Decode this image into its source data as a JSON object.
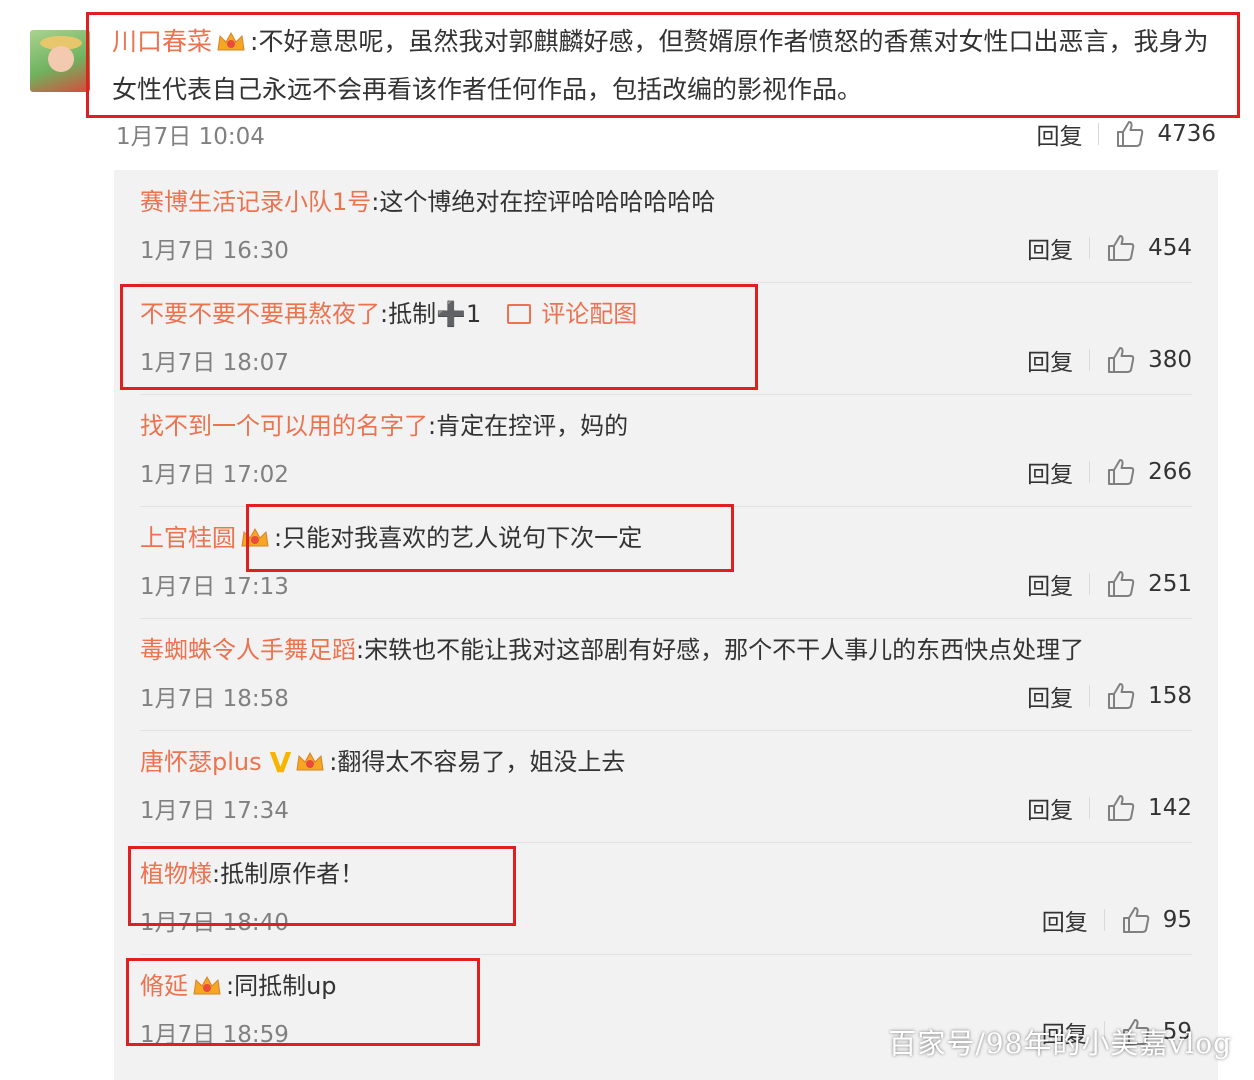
{
  "main_comment": {
    "username": "川口春菜",
    "separator": ":",
    "text": "不好意思呢，虽然我对郭麒麟好感，但赘婿原作者愤怒的香蕉对女性口出恶言，我身为女性代表自己永远不会再看该作者任何作品，包括改编的影视作品。",
    "time": "1月7日 10:04",
    "reply_label": "回复",
    "likes": "4736"
  },
  "replies": [
    {
      "username": "赛博生活记录小队1号",
      "sep": ":",
      "text": "这个博绝对在控评哈哈哈哈哈哈",
      "time": "1月7日 16:30",
      "reply_label": "回复",
      "likes": "454"
    },
    {
      "username": "不要不要不要再熬夜了",
      "sep": ":",
      "text": "抵制",
      "emoji": "➕",
      "text2": "1",
      "pic_label": "评论配图",
      "time": "1月7日 18:07",
      "reply_label": "回复",
      "likes": "380"
    },
    {
      "username": "找不到一个可以用的名字了",
      "sep": ":",
      "text": "肯定在控评，妈的",
      "time": "1月7日 17:02",
      "reply_label": "回复",
      "likes": "266"
    },
    {
      "username": "上官桂圆",
      "sep": ":",
      "text": "只能对我喜欢的艺人说句下次一定",
      "time": "1月7日 17:13",
      "reply_label": "回复",
      "likes": "251"
    },
    {
      "username": "毒蜘蛛令人手舞足蹈",
      "sep": ":",
      "text": "宋轶也不能让我对这部剧有好感，那个不干人事儿的东西快点处理了",
      "time": "1月7日 18:58",
      "reply_label": "回复",
      "likes": "158"
    },
    {
      "username": "唐怀瑟plus",
      "vbadge": "V",
      "sep": ":",
      "text": "翻得太不容易了，姐没上去",
      "time": "1月7日 17:34",
      "reply_label": "回复",
      "likes": "142"
    },
    {
      "username": "植物様",
      "sep": ":",
      "text": "抵制原作者！",
      "time": "1月7日 18:40",
      "reply_label": "回复",
      "likes": "95"
    },
    {
      "username": "脩延",
      "sep": ":",
      "text": "同抵制up",
      "time": "1月7日 18:59",
      "reply_label": "回复",
      "likes": "59"
    }
  ],
  "watermark": "百家号/98年的小美嘉vlog",
  "colors": {
    "username": "#eb7350",
    "highlight_box": "#e02020",
    "vip_badge": "#f7b500"
  },
  "icons": {
    "like": "thumbs-up-icon",
    "crown": "vip-crown-icon",
    "picture": "picture-icon"
  }
}
